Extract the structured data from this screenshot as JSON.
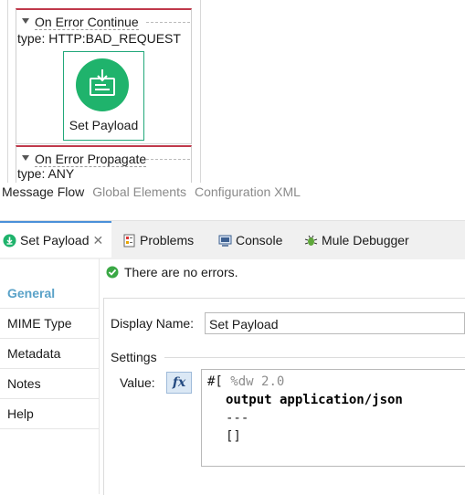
{
  "canvas": {
    "on_error_continue": {
      "title": "On Error Continue",
      "type": "type: HTTP:BAD_REQUEST"
    },
    "on_error_propagate": {
      "title": "On Error Propagate",
      "type": "type: ANY"
    },
    "component": {
      "label": "Set Payload",
      "icon": "set-payload-icon",
      "color": "#1fb36c"
    }
  },
  "editor_tabs": [
    "Message Flow",
    "Global Elements",
    "Configuration XML"
  ],
  "view_tabs": [
    {
      "label": "Set Payload",
      "icon": "set-payload-small-icon"
    },
    {
      "label": "Problems",
      "icon": "problems-icon"
    },
    {
      "label": "Console",
      "icon": "console-icon"
    },
    {
      "label": "Mule Debugger",
      "icon": "debugger-icon"
    }
  ],
  "status": {
    "text": "There are no errors.",
    "color": "#3aa845"
  },
  "nav": [
    "General",
    "MIME Type",
    "Metadata",
    "Notes",
    "Help"
  ],
  "form": {
    "display_name_label": "Display Name:",
    "display_name_value": "Set Payload",
    "settings_label": "Settings",
    "value_label": "Value:",
    "fx_label": "fx",
    "expr_prefix": "#[",
    "code": [
      "%dw 2.0",
      "output application/json",
      "---",
      "[]"
    ]
  },
  "colors": {
    "accent": "#4a90d9",
    "error_border": "#c0394b",
    "nav_active": "#5aa2c8"
  }
}
